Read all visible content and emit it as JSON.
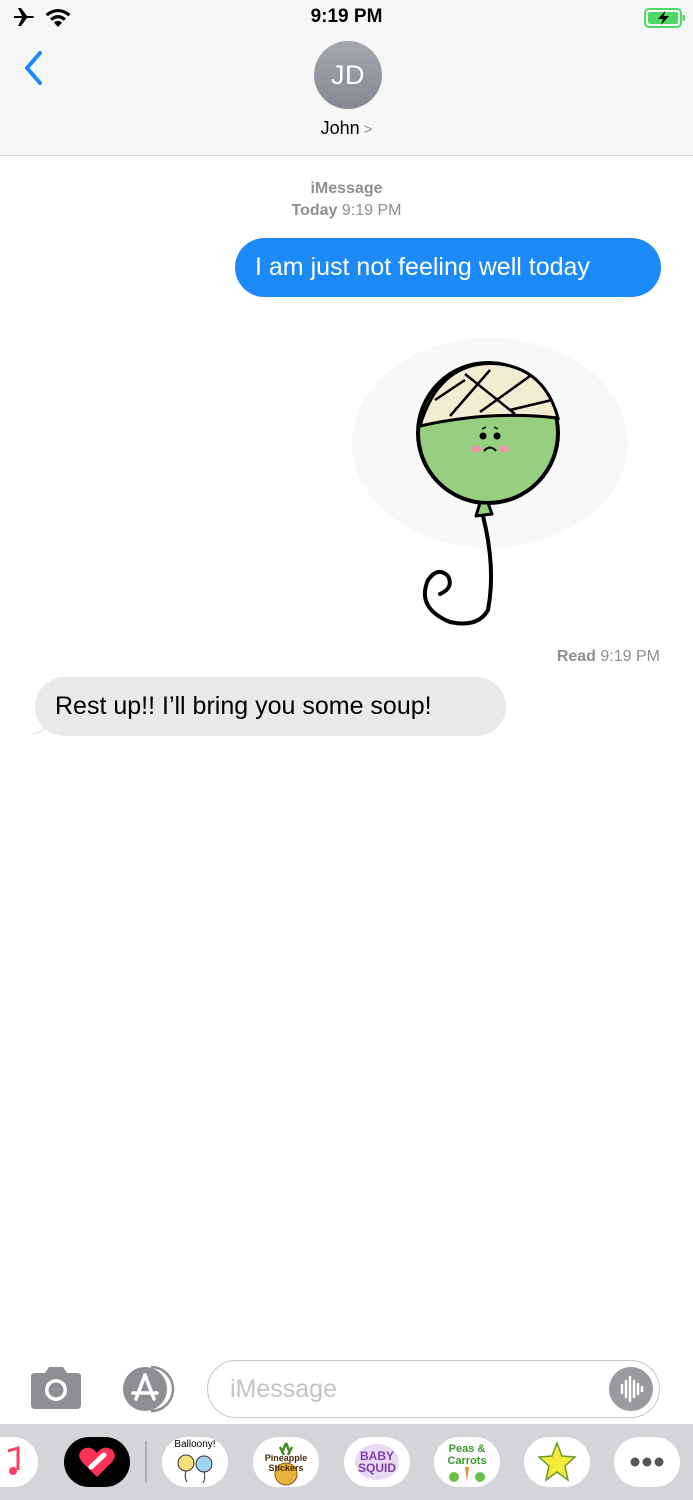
{
  "status_bar": {
    "time": "9:19 PM"
  },
  "header": {
    "contact_initials": "JD",
    "contact_name": "John",
    "chevron": ">"
  },
  "conversation": {
    "service_label": "iMessage",
    "date_day": "Today",
    "date_time": "9:19 PM",
    "sent_message": "I am just not feeling well today",
    "sticker": "green-balloon-bandaged-sticker",
    "read_label": "Read",
    "read_time": "9:19 PM",
    "received_message": "Rest up!! I’ll bring you some soup!"
  },
  "input": {
    "placeholder": "iMessage"
  },
  "drawer": {
    "apps": [
      {
        "id": "music",
        "label": ""
      },
      {
        "id": "digital-touch",
        "label": ""
      },
      {
        "id": "balloony",
        "label": "Balloony!"
      },
      {
        "id": "pineapple",
        "label": "Pineapple Stickers"
      },
      {
        "id": "baby-squid",
        "label": "BABY SQUID"
      },
      {
        "id": "peas-carrots",
        "label": "Peas & Carrots"
      },
      {
        "id": "star-sticker",
        "label": ""
      },
      {
        "id": "more",
        "label": ""
      }
    ]
  },
  "colors": {
    "accent": "#1b8af7",
    "incoming_bubble": "#e9e9eb",
    "secondary_text": "#8e8e93",
    "battery": "#4cd964"
  }
}
